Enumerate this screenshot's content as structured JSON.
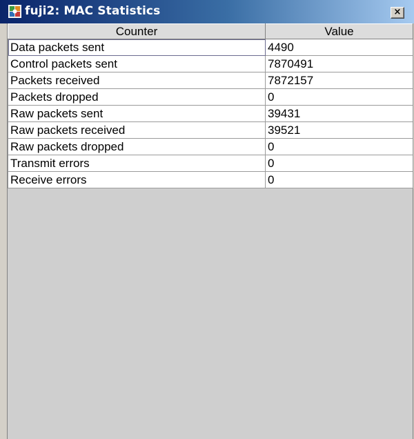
{
  "window": {
    "title": "fuji2: MAC Statistics",
    "close_label": "×"
  },
  "table": {
    "headers": {
      "counter": "Counter",
      "value": "Value"
    },
    "rows": [
      {
        "counter": "Data packets sent",
        "value": "4490"
      },
      {
        "counter": "Control packets sent",
        "value": "7870491"
      },
      {
        "counter": "Packets received",
        "value": "7872157"
      },
      {
        "counter": "Packets dropped",
        "value": "0"
      },
      {
        "counter": "Raw packets sent",
        "value": "39431"
      },
      {
        "counter": "Raw packets received",
        "value": "39521"
      },
      {
        "counter": "Raw packets dropped",
        "value": "0"
      },
      {
        "counter": "Transmit errors",
        "value": "0"
      },
      {
        "counter": "Receive errors",
        "value": "0"
      }
    ]
  }
}
